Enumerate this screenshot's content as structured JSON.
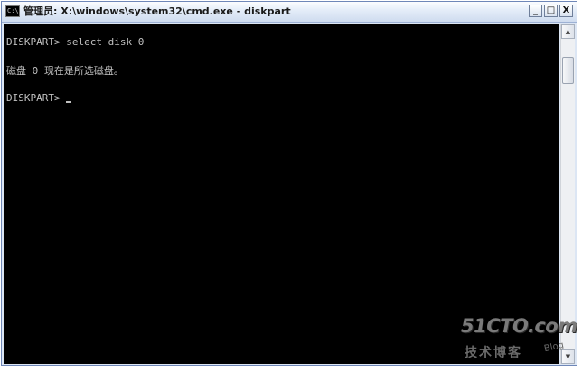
{
  "window": {
    "title": "管理员: X:\\windows\\system32\\cmd.exe - diskpart",
    "icon": "cmd-icon",
    "icon_glyph": "C:\\",
    "controls": {
      "minimize": "_",
      "maximize": "□",
      "close": "X"
    }
  },
  "console": {
    "lines": [
      "DISKPART> select disk 0",
      "磁盘 0 现在是所选磁盘。",
      "DISKPART> "
    ],
    "text_color": "#c0c0c0",
    "background": "#000000"
  },
  "scrollbar": {
    "up_arrow": "▲",
    "down_arrow": "▼"
  },
  "watermark": {
    "main": "51CTO.com",
    "sub": "技术博客",
    "tag": "Blog"
  }
}
